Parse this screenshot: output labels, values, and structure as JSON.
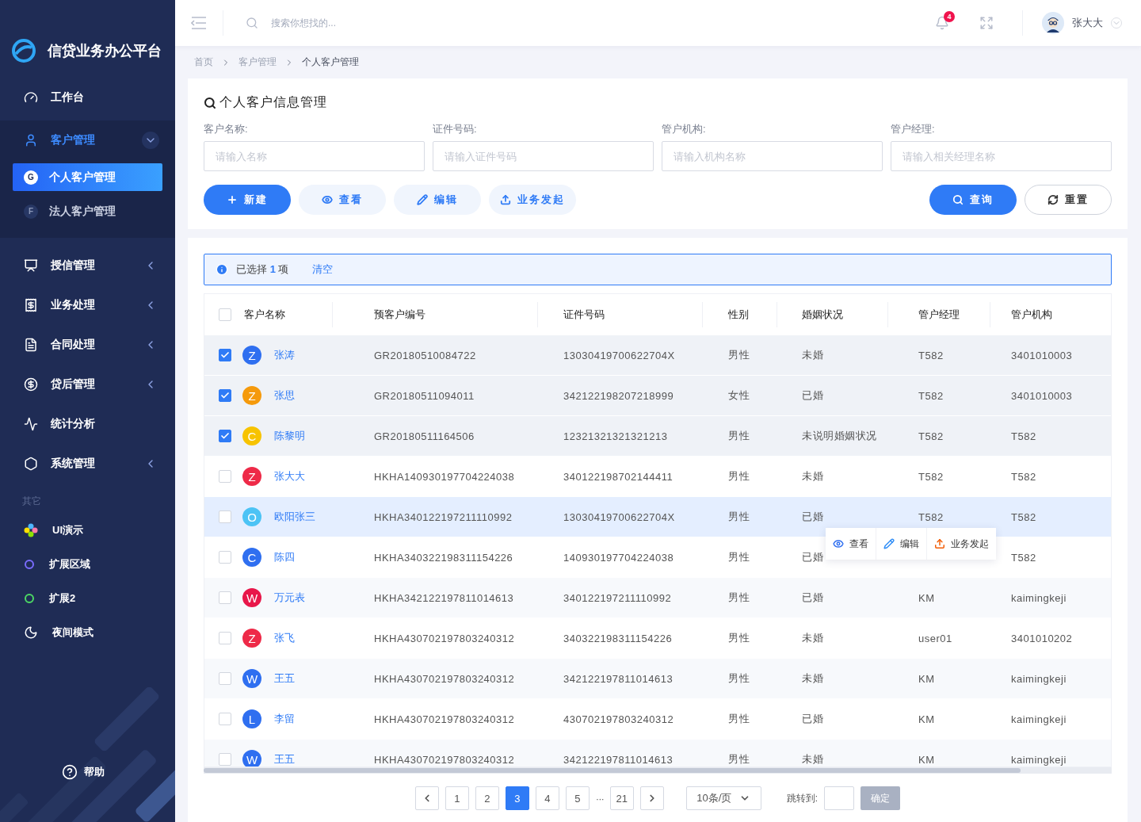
{
  "sidebar": {
    "brand": "信贷业务办公平台",
    "nav": [
      {
        "label": "工作台",
        "selected": false
      },
      {
        "label": "客户管理",
        "selected": true,
        "expanded": true,
        "children": [
          {
            "badge": "G",
            "label": "个人客户管理",
            "selected": true
          },
          {
            "badge": "F",
            "label": "法人客户管理",
            "selected": false
          }
        ]
      },
      {
        "label": "授信管理",
        "selected": false,
        "expanded": false
      },
      {
        "label": "业务处理",
        "selected": false,
        "expanded": false
      },
      {
        "label": "合同处理",
        "selected": false,
        "expanded": false
      },
      {
        "label": "贷后管理",
        "selected": false,
        "expanded": false
      },
      {
        "label": "统计分析",
        "selected": false
      },
      {
        "label": "系统管理",
        "selected": false,
        "expanded": false
      }
    ],
    "section": "其它",
    "extras": [
      {
        "label": "UI演示"
      },
      {
        "label": "扩展区域"
      },
      {
        "label": "扩展2"
      },
      {
        "label": "夜间模式"
      }
    ],
    "help": "帮助"
  },
  "header": {
    "search": {
      "placeholder": "搜索你想找的..."
    },
    "notifications": "4",
    "user": "张大大"
  },
  "breadcrumb": [
    "首页",
    "客户管理",
    "个人客户管理"
  ],
  "filter": {
    "title": "个人客户信息管理",
    "fields": [
      {
        "label": "客户名称:",
        "placeholder": "请输入名称"
      },
      {
        "label": "证件号码:",
        "placeholder": "请输入证件号码"
      },
      {
        "label": "管户机构:",
        "placeholder": "请输入机构名称"
      },
      {
        "label": "管户经理:",
        "placeholder": "请输入相关经理名称"
      }
    ],
    "actions": [
      {
        "kind": "create",
        "label": "新建"
      },
      {
        "kind": "view",
        "label": "查看"
      },
      {
        "kind": "edit",
        "label": "编辑"
      },
      {
        "kind": "launch",
        "label": "业务发起"
      }
    ],
    "submit": [
      {
        "kind": "search",
        "label": "查询"
      },
      {
        "kind": "reset",
        "label": "重置"
      }
    ]
  },
  "selection": {
    "text": "已选择 **1** 项",
    "clear": "清空"
  },
  "table": {
    "all_checked": false,
    "columns": [
      "客户名称",
      "预客户编号",
      "证件号码",
      "性别",
      "婚姻状况",
      "管户经理",
      "管户机构"
    ],
    "rows": [
      {
        "selected": true,
        "hovered": false,
        "initial": "Z",
        "color": "#2f6ff0",
        "name": "张涛",
        "code": "GR20180510084722",
        "id": "13030419700622704X",
        "gender": "男性",
        "marital": "未婚",
        "manager": "T582",
        "org": "3401010003"
      },
      {
        "selected": true,
        "hovered": false,
        "initial": "Z",
        "color": "#f59a0c",
        "name": "张思",
        "code": "GR20180511094011",
        "id": "342122198207218999",
        "gender": "女性",
        "marital": "已婚",
        "manager": "T582",
        "org": "3401010003"
      },
      {
        "selected": true,
        "hovered": false,
        "initial": "C",
        "color": "#f7c300",
        "name": "陈黎明",
        "code": "GR20180511164506",
        "id": "12321321321321213",
        "gender": "男性",
        "marital": "未说明婚姻状况",
        "manager": "T582",
        "org": "T582"
      },
      {
        "selected": false,
        "hovered": false,
        "initial": "Z",
        "color": "#ee2a48",
        "name": "张大大",
        "code": "HKHA140930197704224038",
        "id": "340122198702144411",
        "gender": "男性",
        "marital": "未婚",
        "manager": "T582",
        "org": "T582"
      },
      {
        "selected": false,
        "hovered": true,
        "initial": "O",
        "color": "#4cc3f5",
        "name": "欧阳张三",
        "code": "HKHA340122197211110992",
        "id": "13030419700622704X",
        "gender": "男性",
        "marital": "已婚",
        "manager": "T582",
        "org": "T582"
      },
      {
        "selected": false,
        "hovered": false,
        "initial": "C",
        "color": "#2f6ff0",
        "name": "陈四",
        "code": "HKHA340322198311154226",
        "id": "140930197704224038",
        "gender": "男性",
        "marital": "已婚",
        "org": "T582"
      },
      {
        "selected": false,
        "hovered": false,
        "initial": "W",
        "color": "#e8174a",
        "name": "万元表",
        "code": "HKHA342122197811014613",
        "id": "340122197211110992",
        "gender": "男性",
        "marital": "已婚",
        "manager": "KM",
        "org": "kaimingkeji"
      },
      {
        "selected": false,
        "hovered": false,
        "initial": "Z",
        "color": "#ee2a48",
        "name": "张飞",
        "code": "HKHA430702197803240312",
        "id": "340322198311154226",
        "gender": "男性",
        "marital": "未婚",
        "manager": "user01",
        "org": "3401010202"
      },
      {
        "selected": false,
        "hovered": false,
        "initial": "W",
        "color": "#2f6ff0",
        "name": "王五",
        "code": "HKHA430702197803240312",
        "id": "342122197811014613",
        "gender": "男性",
        "marital": "未婚",
        "manager": "KM",
        "org": "kaimingkeji"
      },
      {
        "selected": false,
        "hovered": false,
        "initial": "L",
        "color": "#2f6ff0",
        "name": "李留",
        "code": "HKHA430702197803240312",
        "id": "430702197803240312",
        "gender": "男性",
        "marital": "已婚",
        "manager": "KM",
        "org": "kaimingkeji"
      },
      {
        "selected": false,
        "hovered": false,
        "initial": "W",
        "color": "#2f6ff0",
        "name": "王五",
        "code": "HKHA430702197803240312",
        "id": "342122197811014613",
        "gender": "男性",
        "marital": "未婚",
        "manager": "KM",
        "org": "kaimingkeji"
      }
    ],
    "row_actions": [
      {
        "kind": "view",
        "label": "查看"
      },
      {
        "kind": "edit",
        "label": "编辑"
      },
      {
        "kind": "launch",
        "label": "业务发起"
      }
    ]
  },
  "pagination": {
    "pages": [
      {
        "label": "1",
        "selected": false
      },
      {
        "label": "2",
        "selected": false
      },
      {
        "label": "3",
        "selected": true
      },
      {
        "label": "4",
        "selected": false
      },
      {
        "label": "5",
        "selected": false
      },
      {
        "label": "21",
        "selected": false
      }
    ],
    "ellipsis": "···",
    "page_size": "10条/页",
    "jump_label": "跳转到:",
    "confirm": "确定",
    "confirm_disabled": true
  }
}
